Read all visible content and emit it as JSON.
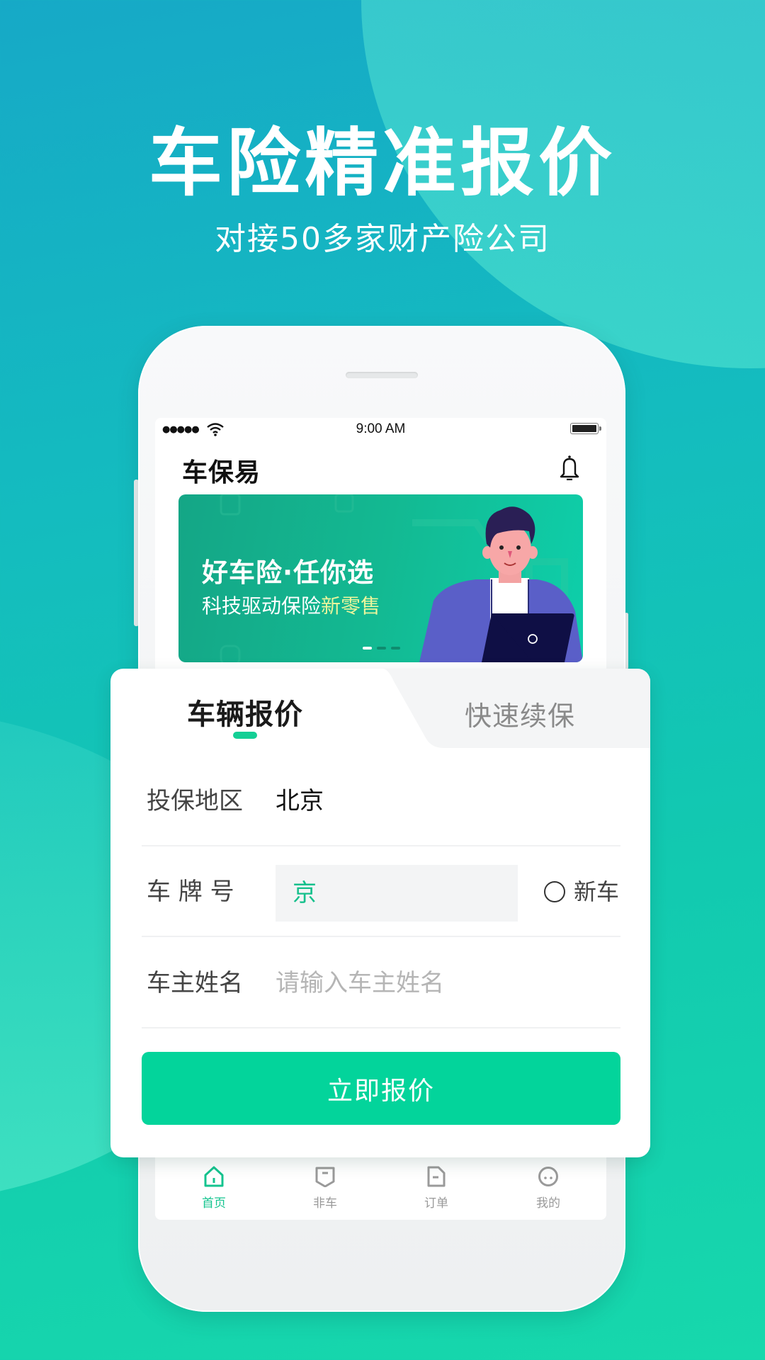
{
  "promo": {
    "headline": "车险精准报价",
    "subheadline": "对接50多家财产险公司"
  },
  "status_bar": {
    "signal": "●●●●●",
    "time": "9:00 AM"
  },
  "app": {
    "title": "车保易"
  },
  "banner": {
    "title": "好车险·任你选",
    "subtitle_main": "科技驱动保险",
    "subtitle_highlight": "新零售",
    "slides_total": 3,
    "slide_active": 1
  },
  "quote_card": {
    "tabs": [
      {
        "label": "车辆报价",
        "active": true
      },
      {
        "label": "快速续保",
        "active": false
      }
    ],
    "fields": {
      "region": {
        "label": "投保地区",
        "value": "北京"
      },
      "plate": {
        "label": "车 牌 号",
        "value": "京",
        "new_car_label": "新车",
        "new_car_checked": false
      },
      "owner": {
        "label": "车主姓名",
        "value": "",
        "placeholder": "请输入车主姓名"
      }
    },
    "submit_label": "立即报价"
  },
  "tab_bar": {
    "items": [
      {
        "label": "首页",
        "icon": "home-icon",
        "active": true
      },
      {
        "label": "非车",
        "icon": "shield-icon",
        "active": false
      },
      {
        "label": "订单",
        "icon": "document-icon",
        "active": false
      },
      {
        "label": "我的",
        "icon": "profile-icon",
        "active": false
      }
    ]
  },
  "colors": {
    "accent": "#03d49b",
    "tab_active": "#15c48f",
    "tab_inactive": "#9a9a9a",
    "banner_highlight": "#eaf59c"
  }
}
